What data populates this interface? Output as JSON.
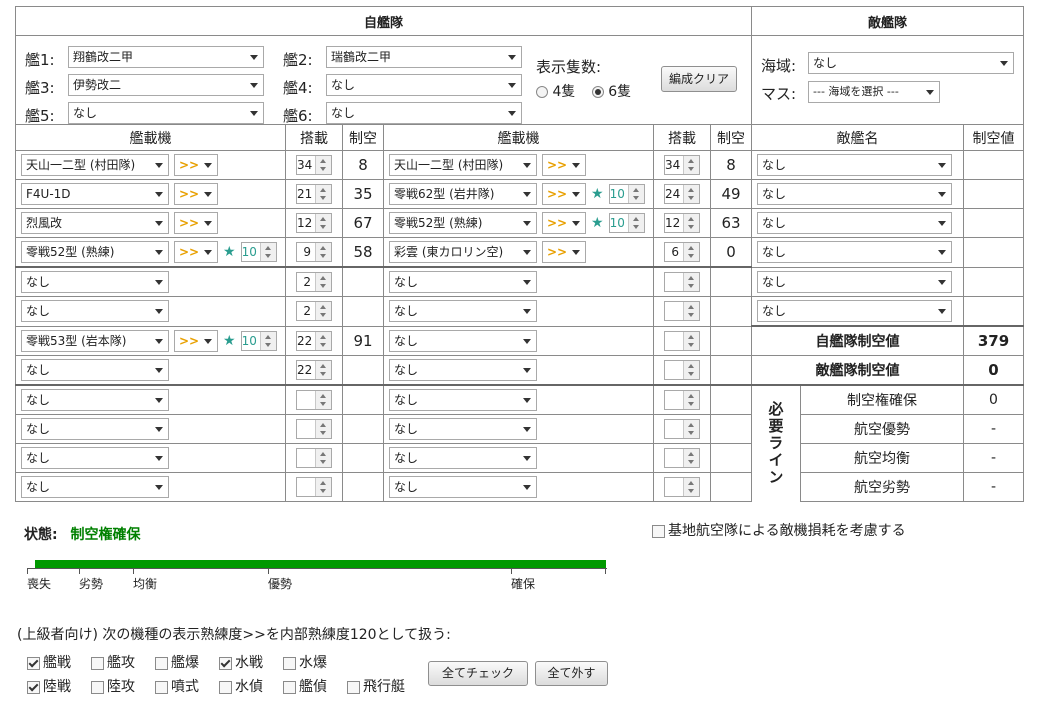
{
  "titles": {
    "own": "自艦隊",
    "enemy": "敵艦隊"
  },
  "ships": [
    {
      "label": "艦1:",
      "name": "翔鶴改二甲"
    },
    {
      "label": "艦2:",
      "name": "瑞鶴改二甲"
    },
    {
      "label": "艦3:",
      "name": "伊勢改二"
    },
    {
      "label": "艦4:",
      "name": "なし"
    },
    {
      "label": "艦5:",
      "name": "なし"
    },
    {
      "label": "艦6:",
      "name": "なし"
    }
  ],
  "display": {
    "label": "表示隻数:",
    "opt4": "4隻",
    "opt6": "6隻",
    "selected": "6隻"
  },
  "clear_button": "編成クリア",
  "enemy_area": {
    "sea_label": "海域:",
    "sea_value": "なし",
    "mass_label": "マス:",
    "mass_value": "--- 海域を選択 ---"
  },
  "col": {
    "aircraft": "艦載機",
    "slots": "搭載",
    "air": "制空",
    "enemy_name": "敵艦名",
    "enemy_air": "制空値"
  },
  "eq_left": [
    {
      "name": "天山一二型 (村田隊)",
      "prof": ">>",
      "impr": "",
      "slot": "34",
      "air": "8"
    },
    {
      "name": "F4U-1D",
      "prof": ">>",
      "impr": "",
      "slot": "21",
      "air": "35"
    },
    {
      "name": "烈風改",
      "prof": ">>",
      "impr": "",
      "slot": "12",
      "air": "67"
    },
    {
      "name": "零戦52型 (熟練)",
      "prof": ">>",
      "impr": "10",
      "slot": "9",
      "air": "58"
    },
    {
      "name": "なし",
      "prof": "",
      "impr": "",
      "slot": "2",
      "air": ""
    },
    {
      "name": "なし",
      "prof": "",
      "impr": "",
      "slot": "2",
      "air": ""
    },
    {
      "name": "零戦53型 (岩本隊)",
      "prof": ">>",
      "impr": "10",
      "slot": "22",
      "air": "91"
    },
    {
      "name": "なし",
      "prof": "",
      "impr": "",
      "slot": "22",
      "air": ""
    },
    {
      "name": "なし",
      "prof": "",
      "impr": "",
      "slot": "",
      "air": ""
    },
    {
      "name": "なし",
      "prof": "",
      "impr": "",
      "slot": "",
      "air": ""
    },
    {
      "name": "なし",
      "prof": "",
      "impr": "",
      "slot": "",
      "air": ""
    },
    {
      "name": "なし",
      "prof": "",
      "impr": "",
      "slot": "",
      "air": ""
    }
  ],
  "eq_right": [
    {
      "name": "天山一二型 (村田隊)",
      "prof": ">>",
      "impr": "",
      "slot": "34",
      "air": "8"
    },
    {
      "name": "零戦62型 (岩井隊)",
      "prof": ">>",
      "impr": "10",
      "slot": "24",
      "air": "49"
    },
    {
      "name": "零戦52型 (熟練)",
      "prof": ">>",
      "impr": "10",
      "slot": "12",
      "air": "63"
    },
    {
      "name": "彩雲 (東カロリン空)",
      "prof": ">>",
      "impr": "",
      "slot": "6",
      "air": "0"
    },
    {
      "name": "なし",
      "prof": "",
      "impr": "",
      "slot": "",
      "air": ""
    },
    {
      "name": "なし",
      "prof": "",
      "impr": "",
      "slot": "",
      "air": ""
    },
    {
      "name": "なし",
      "prof": "",
      "impr": "",
      "slot": "",
      "air": ""
    },
    {
      "name": "なし",
      "prof": "",
      "impr": "",
      "slot": "",
      "air": ""
    },
    {
      "name": "なし",
      "prof": "",
      "impr": "",
      "slot": "",
      "air": ""
    },
    {
      "name": "なし",
      "prof": "",
      "impr": "",
      "slot": "",
      "air": ""
    },
    {
      "name": "なし",
      "prof": "",
      "impr": "",
      "slot": "",
      "air": ""
    },
    {
      "name": "なし",
      "prof": "",
      "impr": "",
      "slot": "",
      "air": ""
    }
  ],
  "enemy_ships": [
    "なし",
    "なし",
    "なし",
    "なし",
    "なし",
    "なし"
  ],
  "totals": {
    "own_label": "自艦隊制空値",
    "own_value": "379",
    "enemy_label": "敵艦隊制空値",
    "enemy_value": "0"
  },
  "required": {
    "title": "必要ライン",
    "rows": [
      {
        "label": "制空権確保",
        "value": "0"
      },
      {
        "label": "航空優勢",
        "value": "-"
      },
      {
        "label": "航空均衡",
        "value": "-"
      },
      {
        "label": "航空劣勢",
        "value": "-"
      }
    ]
  },
  "status": {
    "label": "状態:",
    "value": "制空権確保",
    "color": "#008000"
  },
  "land_base": "基地航空隊による敵機損耗を考慮する",
  "gauge": {
    "fill": 1.0,
    "color": "#009900",
    "labels": [
      "喪失",
      "劣勢",
      "均衡",
      "優勢",
      "確保"
    ]
  },
  "advanced": {
    "text": "(上級者向け) 次の機種の表示熟練度>>を内部熟練度120として扱う:",
    "types": [
      {
        "name": "艦戦",
        "checked": true
      },
      {
        "name": "艦攻",
        "checked": false
      },
      {
        "name": "艦爆",
        "checked": false
      },
      {
        "name": "水戦",
        "checked": true
      },
      {
        "name": "水爆",
        "checked": false
      },
      {
        "name": "陸戦",
        "checked": true
      },
      {
        "name": "陸攻",
        "checked": false
      },
      {
        "name": "噴式",
        "checked": false
      },
      {
        "name": "水偵",
        "checked": false
      },
      {
        "name": "艦偵",
        "checked": false
      },
      {
        "name": "飛行艇",
        "checked": false
      }
    ],
    "check_all": "全てチェック",
    "uncheck_all": "全て外す"
  }
}
